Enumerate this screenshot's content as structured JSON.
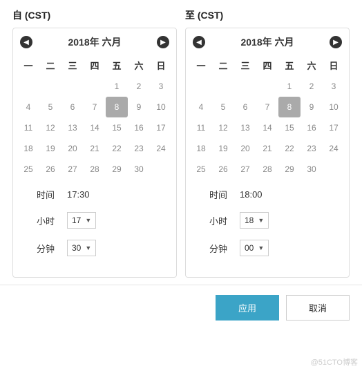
{
  "from": {
    "title": "自 (CST)",
    "month_title": "2018年 六月",
    "dow": [
      "一",
      "二",
      "三",
      "四",
      "五",
      "六",
      "日"
    ],
    "leading_blanks": 4,
    "days": 30,
    "selected": 8,
    "time_label": "时间",
    "time_value": "17:30",
    "hour_label": "小时",
    "hour_value": "17",
    "minute_label": "分钟",
    "minute_value": "30"
  },
  "to": {
    "title": "至 (CST)",
    "month_title": "2018年 六月",
    "dow": [
      "一",
      "二",
      "三",
      "四",
      "五",
      "六",
      "日"
    ],
    "leading_blanks": 4,
    "days": 30,
    "selected": 8,
    "time_label": "时间",
    "time_value": "18:00",
    "hour_label": "小时",
    "hour_value": "18",
    "minute_label": "分钟",
    "minute_value": "00"
  },
  "buttons": {
    "apply": "应用",
    "cancel": "取消"
  },
  "watermark": "@51CTO博客"
}
